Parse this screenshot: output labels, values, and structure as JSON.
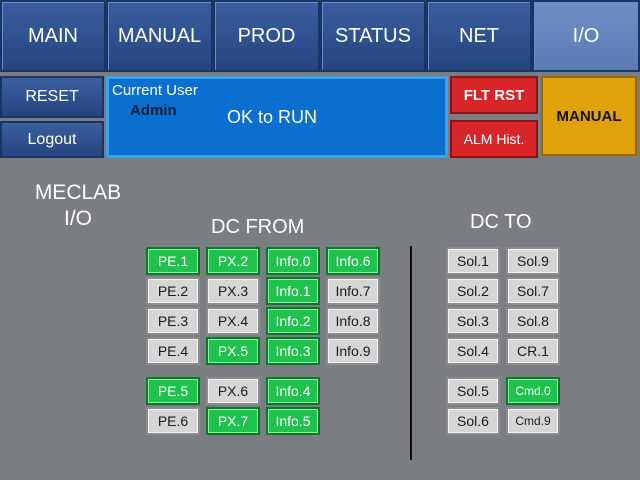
{
  "nav": [
    {
      "label": "MAIN",
      "active": false
    },
    {
      "label": "MANUAL",
      "active": false
    },
    {
      "label": "PROD",
      "active": false
    },
    {
      "label": "STATUS",
      "active": false
    },
    {
      "label": "NET",
      "active": false
    },
    {
      "label": "I/O",
      "active": true
    }
  ],
  "side": {
    "reset": "RESET",
    "logout": "Logout"
  },
  "status": {
    "current_user_label": "Current User",
    "user": "Admin",
    "run_status": "OK to RUN"
  },
  "alarm": {
    "fault_reset": "FLT RST",
    "alarm_history": "ALM Hist."
  },
  "mode_button": "MANUAL",
  "page_title": {
    "line1": "MECLAB",
    "line2": "I/O"
  },
  "dc_from": {
    "title": "DC FROM",
    "columns": [
      [
        {
          "label": "PE.1",
          "on": true
        },
        {
          "label": "PE.2",
          "on": false
        },
        {
          "label": "PE.3",
          "on": false
        },
        {
          "label": "PE.4",
          "on": false
        },
        {
          "label": "PE.5",
          "on": true
        },
        {
          "label": "PE.6",
          "on": false
        }
      ],
      [
        {
          "label": "PX.2",
          "on": true
        },
        {
          "label": "PX.3",
          "on": false
        },
        {
          "label": "PX.4",
          "on": false
        },
        {
          "label": "PX.5",
          "on": true
        },
        {
          "label": "PX.6",
          "on": false
        },
        {
          "label": "PX.7",
          "on": true
        }
      ],
      [
        {
          "label": "Info.0",
          "on": true
        },
        {
          "label": "Info.1",
          "on": true
        },
        {
          "label": "Info.2",
          "on": true
        },
        {
          "label": "Info.3",
          "on": true
        },
        {
          "label": "Info.4",
          "on": true
        },
        {
          "label": "Info.5",
          "on": true
        }
      ],
      [
        {
          "label": "Info.6",
          "on": true
        },
        {
          "label": "Info.7",
          "on": false
        },
        {
          "label": "Info.8",
          "on": false
        },
        {
          "label": "Info.9",
          "on": false
        }
      ]
    ]
  },
  "dc_to": {
    "title": "DC TO",
    "columns": [
      [
        {
          "label": "Sol.1",
          "on": false
        },
        {
          "label": "Sol.2",
          "on": false
        },
        {
          "label": "Sol.3",
          "on": false
        },
        {
          "label": "Sol.4",
          "on": false
        },
        {
          "label": "Sol.5",
          "on": false
        },
        {
          "label": "Sol.6",
          "on": false
        }
      ],
      [
        {
          "label": "Sol.9",
          "on": false
        },
        {
          "label": "Sol.7",
          "on": false
        },
        {
          "label": "Sol.8",
          "on": false
        },
        {
          "label": "CR.1",
          "on": false
        },
        {
          "label": "Cmd.0",
          "on": true
        },
        {
          "label": "Cmd.9",
          "on": false
        }
      ]
    ]
  },
  "colors": {
    "panel_blue": "#0b6fd0",
    "on_green": "#1ec24c",
    "alarm_red": "#d8252a",
    "manual_amber": "#e0a20a",
    "background": "#7a7d82"
  }
}
